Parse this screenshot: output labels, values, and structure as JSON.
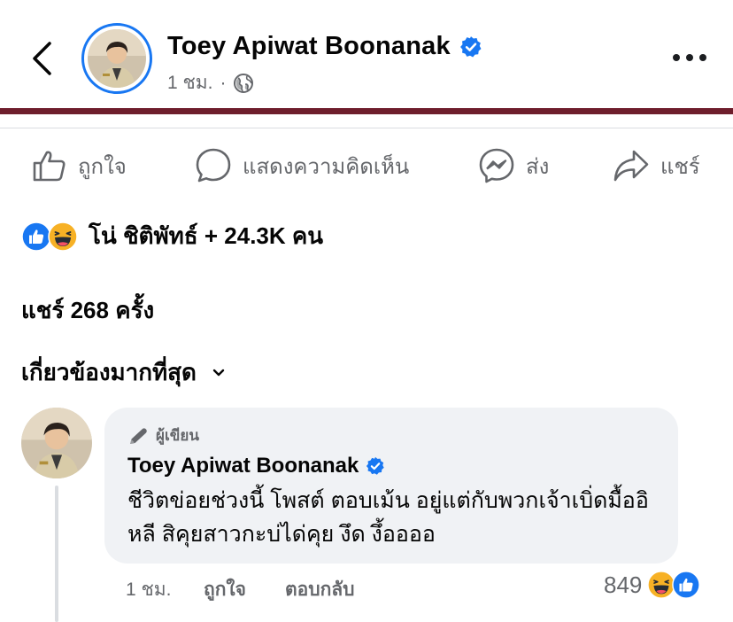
{
  "header": {
    "name": "Toey Apiwat Boonanak",
    "time": "1 ชม.",
    "separator": "·",
    "privacy_icon": "globe-icon",
    "verified_icon": "verified-badge-icon",
    "back_icon": "chevron-left-icon",
    "more_icon": "more-dots-icon"
  },
  "actions": [
    {
      "label": "ถูกใจ",
      "icon": "like-thumb-icon"
    },
    {
      "label": "แสดงความคิดเห็น",
      "icon": "comment-icon"
    },
    {
      "label": "ส่ง",
      "icon": "messenger-icon"
    },
    {
      "label": "แชร์",
      "icon": "share-icon"
    }
  ],
  "reactions": {
    "icons": [
      "like-reaction-icon",
      "haha-reaction-icon"
    ],
    "summary": "โน่ ชิติพัทธ์ + 24.3K คน"
  },
  "shares": "แชร์ 268 ครั้ง",
  "sort": {
    "label": "เกี่ยวข้องมากที่สุด",
    "icon": "chevron-down-icon"
  },
  "comment": {
    "author_tag": "ผู้เขียน",
    "author_tag_icon": "pencil-icon",
    "name": "Toey Apiwat Boonanak",
    "text": "ชีวิตข่อยช่วงนี้ โพสต์ ตอบเม้น อยู่แต่กับพวกเจ้าเบิ่ดมื้ออิหลี สิคุยสาวกะบ่ได่คุย งึด งึ้ออออ",
    "time": "1 ชม.",
    "like_label": "ถูกใจ",
    "reply_label": "ตอบกลับ",
    "reaction_count": "849",
    "reaction_icons": [
      "haha-reaction-icon",
      "like-reaction-icon"
    ]
  },
  "colors": {
    "accent": "#1877f2",
    "secondary_text": "#65676b",
    "bubble": "#f0f2f5",
    "band": "#6e1e2c"
  }
}
